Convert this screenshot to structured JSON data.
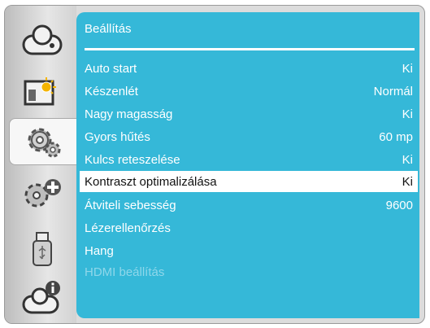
{
  "sidebar": {
    "tabs": [
      {
        "icon": "projector-icon"
      },
      {
        "icon": "picture-settings-icon"
      },
      {
        "icon": "gear-icon"
      },
      {
        "icon": "gear-plus-icon"
      },
      {
        "icon": "usb-icon"
      },
      {
        "icon": "projector-info-icon"
      }
    ]
  },
  "panel": {
    "title": "Beállítás",
    "items": [
      {
        "label": "Auto start",
        "value": "Ki"
      },
      {
        "label": "Készenlét",
        "value": "Normál"
      },
      {
        "label": "Nagy magasság",
        "value": "Ki"
      },
      {
        "label": "Gyors hűtés",
        "value": "60 mp"
      },
      {
        "label": "Kulcs reteszelése",
        "value": "Ki"
      },
      {
        "label": "Kontraszt optimalizálása",
        "value": "Ki"
      },
      {
        "label": "Átviteli sebesség",
        "value": "9600"
      },
      {
        "label": "Lézerellenőrzés",
        "value": ""
      },
      {
        "label": "Hang",
        "value": ""
      },
      {
        "label": "HDMI beállítás",
        "value": ""
      }
    ]
  }
}
